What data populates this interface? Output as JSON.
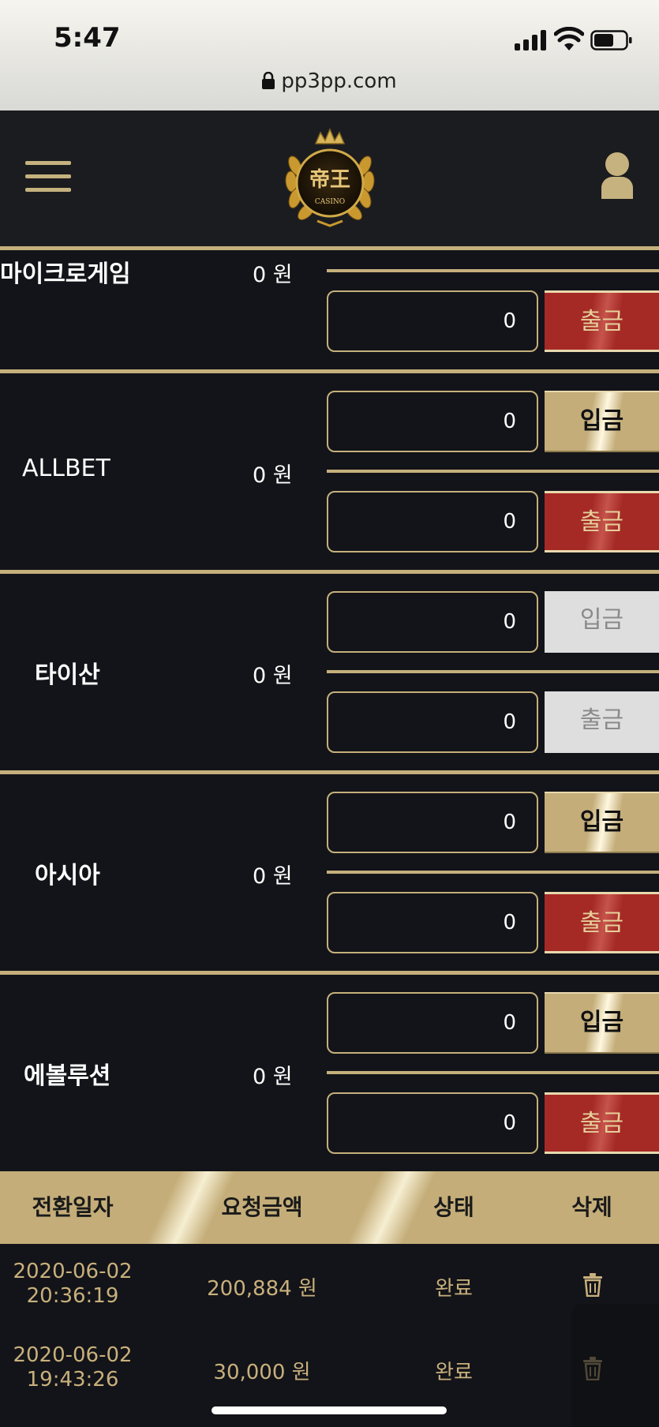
{
  "status_bar": {
    "time": "5:47",
    "url": "pp3pp.com",
    "icons": [
      "signal-icon",
      "wifi-icon",
      "battery-icon",
      "lock-icon"
    ]
  },
  "header": {
    "logo_text": "CASINO",
    "icons": [
      "hamburger-menu-icon",
      "casino-crown-logo",
      "user-icon"
    ]
  },
  "games": [
    {
      "name": "마이크로게임",
      "balance": "0 원",
      "deposit_amount": "",
      "withdraw_amount": "0",
      "deposit_label": "",
      "withdraw_label": "출금"
    },
    {
      "name": "ALLBET",
      "balance": "0 원",
      "deposit_amount": "0",
      "withdraw_amount": "0",
      "deposit_label": "입금",
      "withdraw_label": "출금"
    },
    {
      "name": "타이산",
      "balance": "0 원",
      "deposit_amount": "0",
      "withdraw_amount": "0",
      "deposit_label": "입금",
      "withdraw_label": "출금",
      "disabled": true
    },
    {
      "name": "아시아",
      "balance": "0 원",
      "deposit_amount": "0",
      "withdraw_amount": "0",
      "deposit_label": "입금",
      "withdraw_label": "출금"
    },
    {
      "name": "에볼루션",
      "balance": "0 원",
      "deposit_amount": "0",
      "withdraw_amount": "0",
      "deposit_label": "입금",
      "withdraw_label": "출금"
    }
  ],
  "history": {
    "headers": {
      "date": "전환일자",
      "amount": "요청금액",
      "status": "상태",
      "delete": "삭제"
    },
    "rows": [
      {
        "date": "2020-06-02",
        "time": "20:36:19",
        "amount": "200,884 원",
        "status": "완료"
      },
      {
        "date": "2020-06-02",
        "time": "19:43:26",
        "amount": "30,000 원",
        "status": "완료"
      }
    ]
  },
  "colors": {
    "gold": "#c5b07c",
    "background": "#131419",
    "withdraw_red": "#a52a26",
    "disabled_gray": "#dedede"
  }
}
